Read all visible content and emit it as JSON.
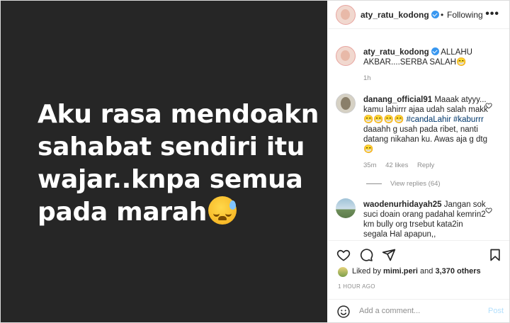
{
  "media": {
    "lines": [
      "Aku rasa mendoakn",
      "sahabat sendiri itu",
      "wajar..knpa semua",
      "pada marah"
    ]
  },
  "header": {
    "username": "aty_ratu_kodong",
    "separator": "•",
    "follow_status": "Following",
    "more": "•••"
  },
  "caption": {
    "username": "aty_ratu_kodong",
    "text": "ALLAHU AKBAR....SERBA SALAH😁",
    "time": "1h"
  },
  "comments": [
    {
      "username": "danang_official91",
      "text_a": "Maaak atyyy... kamu lahirrr ajaa udah salah makk 😁😁😁😁",
      "hashtag1": "#candaLahir",
      "hashtag2": "#kaburrr",
      "text_b": "daaahh g usah pada ribet, nanti datang nikahan ku. Awas aja g dtg😁",
      "time": "35m",
      "likes": "42 likes",
      "reply": "Reply",
      "view_replies": "View replies (64)"
    },
    {
      "username": "waodenurhidayah25",
      "text": "Jangan sok suci doain orang padahal kemrin2 km bully org trsebut kata2in segala Hal apapun,,"
    }
  ],
  "likes": {
    "prefix": "Liked by",
    "user": "mimi.peri",
    "and": "and",
    "others": "3,370 others"
  },
  "time_ago": "1 HOUR AGO",
  "add_comment": {
    "placeholder": "Add a comment...",
    "post": "Post"
  }
}
